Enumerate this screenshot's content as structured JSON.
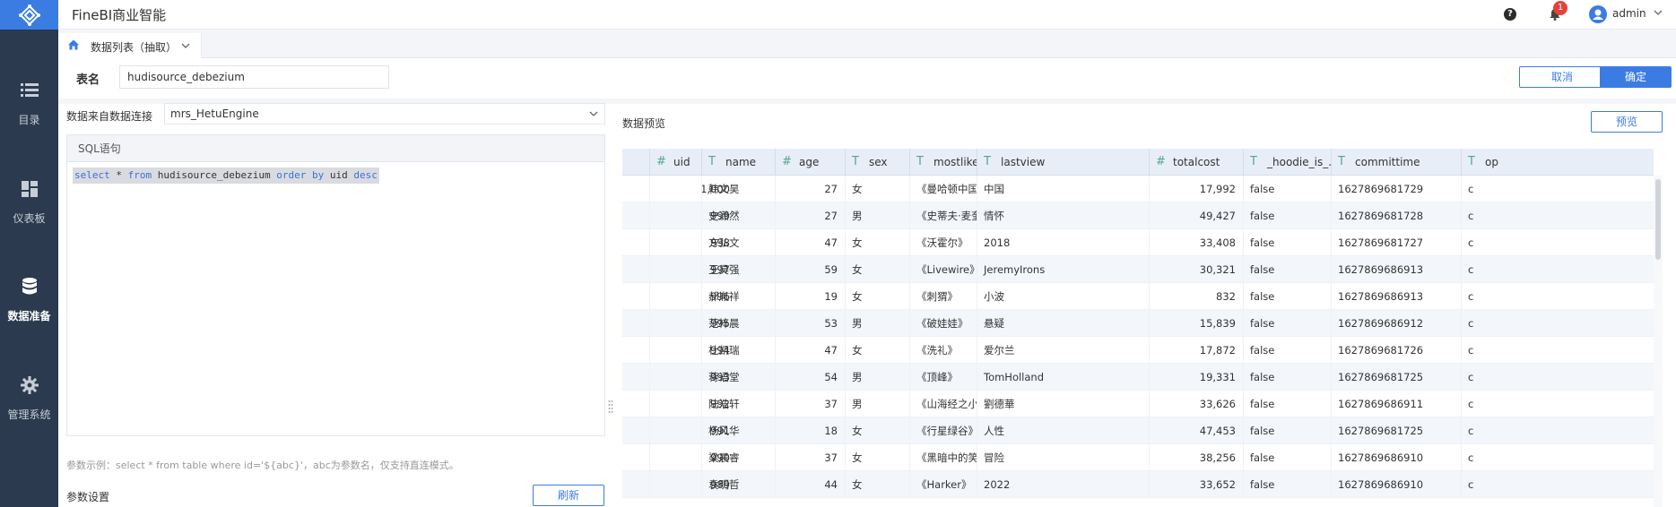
{
  "app": {
    "title": "FineBI商业智能"
  },
  "nav": {
    "items": [
      {
        "label": "目录",
        "icon": "list-icon"
      },
      {
        "label": "仪表板",
        "icon": "dashboard-icon"
      },
      {
        "label": "数据准备",
        "icon": "database-icon",
        "active": true
      },
      {
        "label": "管理系统",
        "icon": "gear-icon"
      }
    ]
  },
  "topbar": {
    "help": "?",
    "notifications": "1",
    "user": "admin"
  },
  "tab": {
    "label": "数据列表（抽取）"
  },
  "table_name": {
    "label": "表名",
    "value": "hudisource_debezium"
  },
  "actions": {
    "cancel": "取消",
    "ok": "确定"
  },
  "source": {
    "label": "数据来自数据连接",
    "value": "mrs_HetuEngine"
  },
  "sql": {
    "header": "SQL语句",
    "tokens": [
      "select",
      " * ",
      "from",
      " hudisource_debezium ",
      "order",
      " ",
      "by",
      " uid ",
      "desc"
    ]
  },
  "params": {
    "hint": "参数示例：select * from table where id='${abc}'，abc为参数名，仅支持直连模式。",
    "label": "参数设置",
    "refresh": "刷新"
  },
  "preview": {
    "label": "数据预览",
    "button": "预览",
    "columns": [
      {
        "name": "uid",
        "type": "#"
      },
      {
        "name": "name",
        "type": "T"
      },
      {
        "name": "age",
        "type": "#"
      },
      {
        "name": "sex",
        "type": "T"
      },
      {
        "name": "mostlike",
        "type": "T"
      },
      {
        "name": "lastview",
        "type": "T"
      },
      {
        "name": "totalcost",
        "type": "#"
      },
      {
        "name": "_hoodie_is_...",
        "type": "T"
      },
      {
        "name": "committime",
        "type": "T"
      },
      {
        "name": "op",
        "type": "T"
      }
    ],
    "rows": [
      [
        "1,000",
        "韩文昊",
        "27",
        "女",
        "《曼哈顿中国女孩》",
        "中国",
        "17,992",
        "false",
        "1627869681729",
        "c"
      ],
      [
        "999",
        "史潇然",
        "27",
        "男",
        "《史蒂夫·麦奎因》",
        "情怀",
        "49,427",
        "false",
        "1627869681728",
        "c"
      ],
      [
        "998",
        "方弘文",
        "47",
        "女",
        "《沃霍尔》",
        "2018",
        "33,408",
        "false",
        "1627869681727",
        "c"
      ],
      [
        "997",
        "王昊强",
        "59",
        "女",
        "《Livewire》",
        "JeremyIrons",
        "30,321",
        "false",
        "1627869686913",
        "c"
      ],
      [
        "996",
        "郝胤祥",
        "19",
        "女",
        "《刺猬》",
        "小波",
        "832",
        "false",
        "1627869686913",
        "c"
      ],
      [
        "995",
        "范梓晨",
        "53",
        "男",
        "《破娃娃》",
        "悬疑",
        "15,839",
        "false",
        "1627869686912",
        "c"
      ],
      [
        "994",
        "杜凯瑞",
        "47",
        "女",
        "《洗礼》",
        "爱尔兰",
        "17,872",
        "false",
        "1627869681726",
        "c"
      ],
      [
        "993",
        "蒋语堂",
        "54",
        "男",
        "《顶峰》",
        "TomHolland",
        "19,331",
        "false",
        "1627869681725",
        "c"
      ],
      [
        "992",
        "陆浩轩",
        "37",
        "男",
        "《山海经之小人国》",
        "劉德華",
        "33,626",
        "false",
        "1627869686911",
        "c"
      ],
      [
        "991",
        "杨风华",
        "18",
        "女",
        "《行星绿谷》",
        "人性",
        "47,453",
        "false",
        "1627869681725",
        "c"
      ],
      [
        "990",
        "梁晨睿",
        "37",
        "女",
        "《黑暗中的笑声》",
        "冒险",
        "38,256",
        "false",
        "1627869686910",
        "c"
      ],
      [
        "989",
        "袁明哲",
        "44",
        "女",
        "《Harker》",
        "2022",
        "33,652",
        "false",
        "1627869686910",
        "c"
      ]
    ]
  }
}
